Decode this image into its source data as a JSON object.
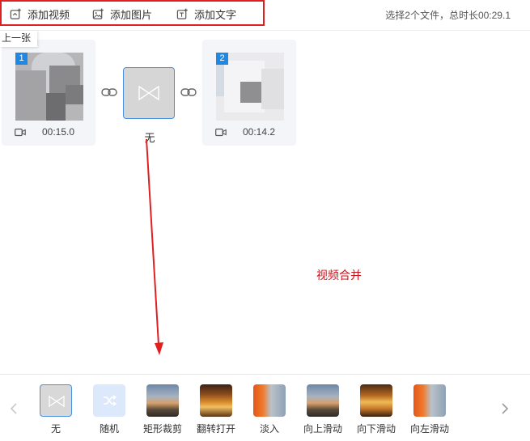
{
  "toolbar": {
    "add_video": "添加视频",
    "add_image": "添加图片",
    "add_text": "添加文字",
    "file_info": "选择2个文件，总时长00:29.1"
  },
  "prev_tag": "上一张",
  "clips": [
    {
      "number": "1",
      "duration": "00:15.0"
    },
    {
      "number": "2",
      "duration": "00:14.2"
    }
  ],
  "transition_slot": {
    "label": "无"
  },
  "annotation": "视频合并",
  "transitions": [
    {
      "label": "无",
      "selected": true
    },
    {
      "label": "随机"
    },
    {
      "label": "矩形裁剪"
    },
    {
      "label": "翻转打开"
    },
    {
      "label": "淡入"
    },
    {
      "label": "向上滑动"
    },
    {
      "label": "向下滑动"
    },
    {
      "label": "向左滑动"
    }
  ],
  "colors": {
    "accent": "#1e88e5",
    "annotation": "#d0101a",
    "highlight_box": "#e02020"
  },
  "icons": [
    "add-video-icon",
    "add-image-icon",
    "add-text-icon",
    "video-camera-icon",
    "link-icon",
    "transition-none-icon",
    "shuffle-icon",
    "chevron-left-icon",
    "chevron-right-icon"
  ]
}
